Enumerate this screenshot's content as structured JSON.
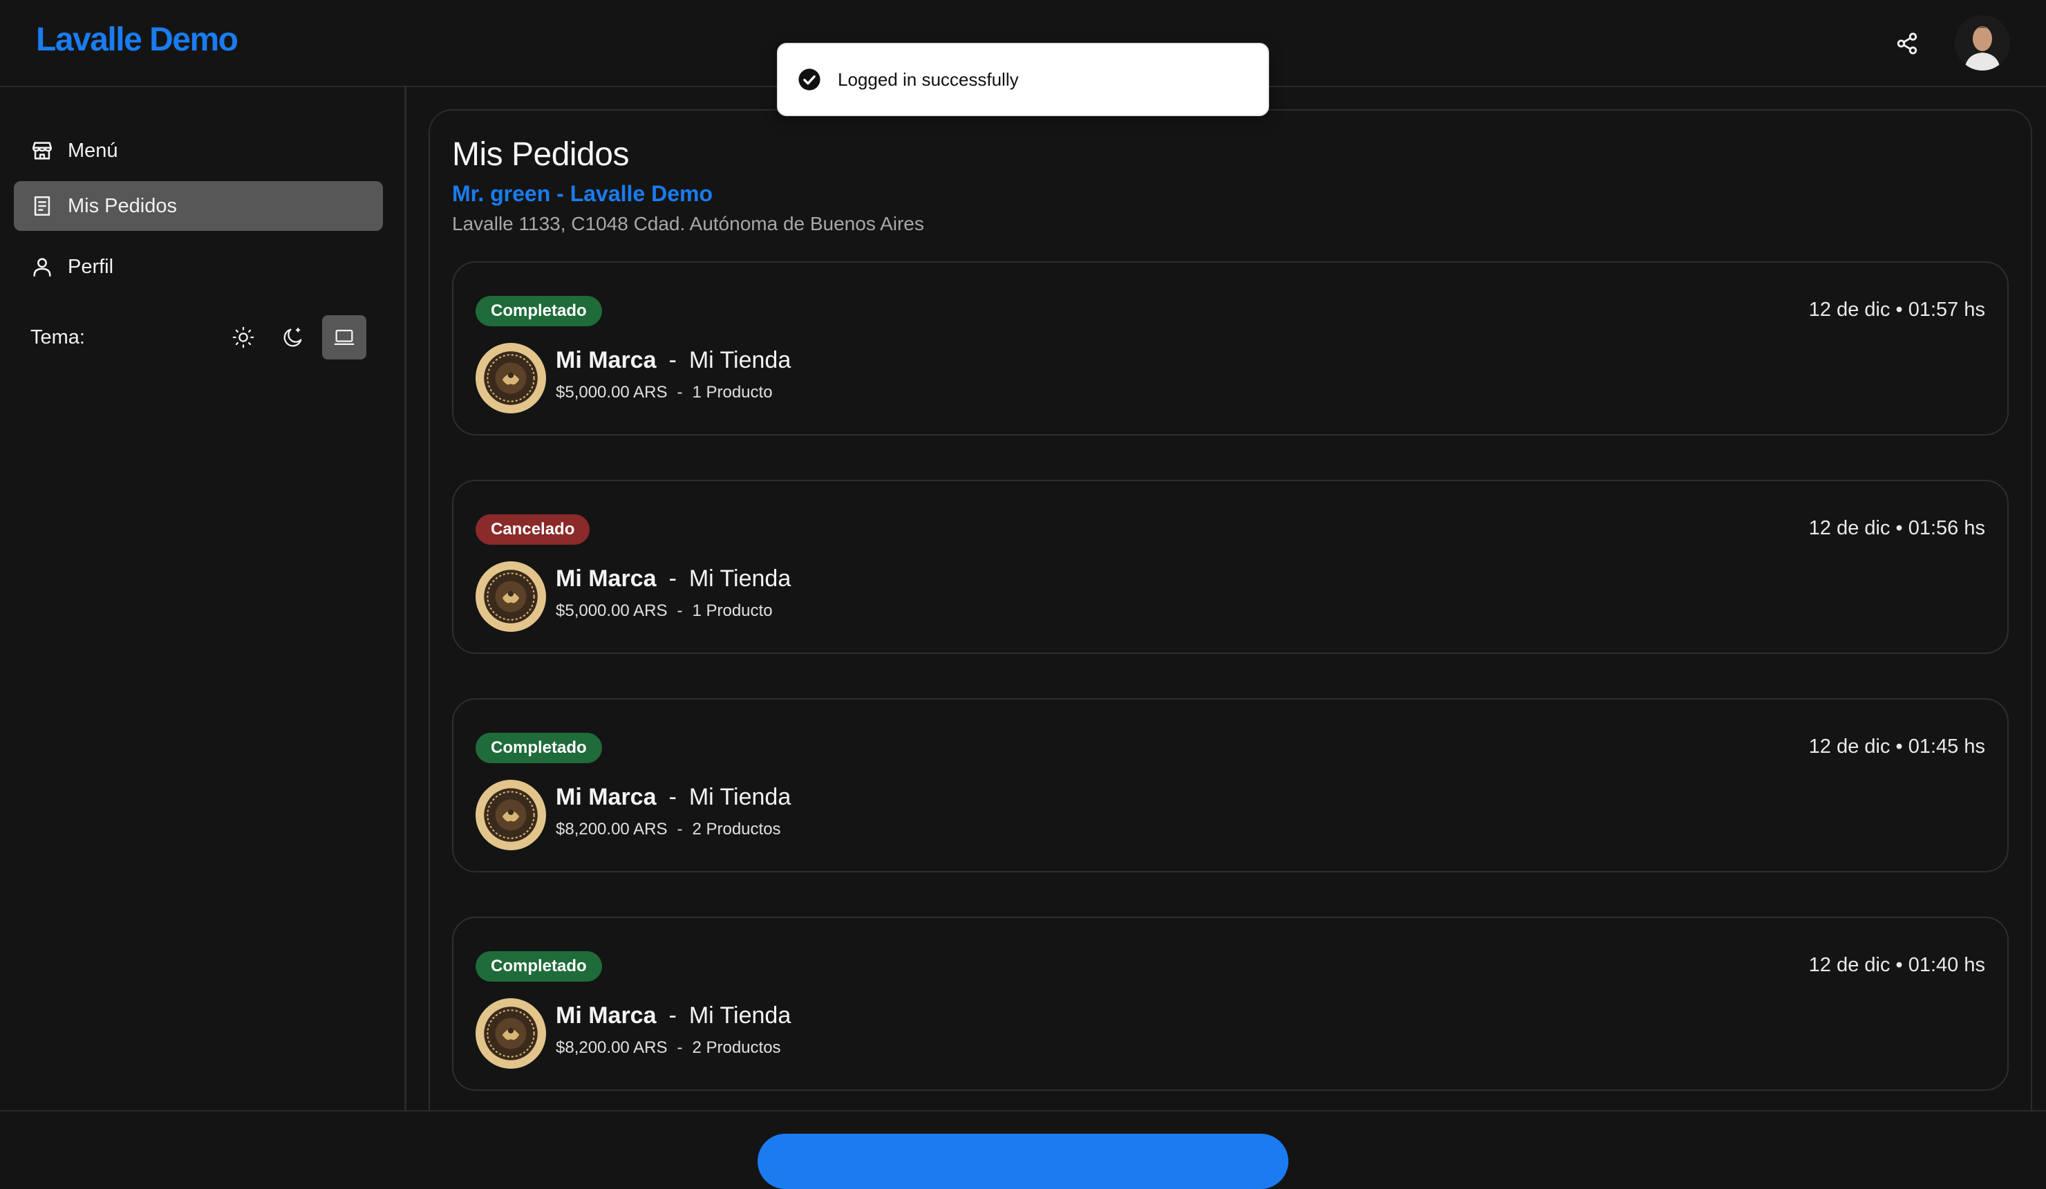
{
  "header": {
    "brand": "Lavalle Demo",
    "share_icon": "share-icon",
    "avatar_icon": "user-avatar"
  },
  "toast": {
    "icon": "check-circle-icon",
    "message": "Logged in successfully"
  },
  "sidebar": {
    "items": [
      {
        "label": "Menú",
        "icon": "store-icon",
        "active": false
      },
      {
        "label": "Mis Pedidos",
        "icon": "receipt-icon",
        "active": true
      },
      {
        "label": "Perfil",
        "icon": "user-icon",
        "active": false
      }
    ],
    "theme": {
      "label": "Tema:",
      "options": [
        "sun-icon",
        "moon-icon",
        "laptop-icon"
      ],
      "selected": "laptop-icon"
    }
  },
  "main": {
    "title": "Mis Pedidos",
    "store_name": "Mr. green - Lavalle Demo",
    "store_address": "Lavalle 1133, C1048 Cdad. Autónoma de Buenos Aires",
    "orders": [
      {
        "status": "Completado",
        "date": "12 de dic • 01:57 hs",
        "brand": "Mi Marca",
        "separator": "-",
        "store": "Mi Tienda",
        "price": "$5,000.00 ARS",
        "sub_separator": "-",
        "products": "1 Producto"
      },
      {
        "status": "Cancelado",
        "date": "12 de dic • 01:56 hs",
        "brand": "Mi Marca",
        "separator": "-",
        "store": "Mi Tienda",
        "price": "$5,000.00 ARS",
        "sub_separator": "-",
        "products": "1 Producto"
      },
      {
        "status": "Completado",
        "date": "12 de dic • 01:45 hs",
        "brand": "Mi Marca",
        "separator": "-",
        "store": "Mi Tienda",
        "price": "$8,200.00 ARS",
        "sub_separator": "-",
        "products": "2 Productos"
      },
      {
        "status": "Completado",
        "date": "12 de dic • 01:40 hs",
        "brand": "Mi Marca",
        "separator": "-",
        "store": "Mi Tienda",
        "price": "$8,200.00 ARS",
        "sub_separator": "-",
        "products": "2 Productos"
      }
    ]
  },
  "colors": {
    "accent": "#1a7cf0",
    "completed": "#1f6b3a",
    "cancelled": "#8b2a2a",
    "background": "#141414"
  }
}
